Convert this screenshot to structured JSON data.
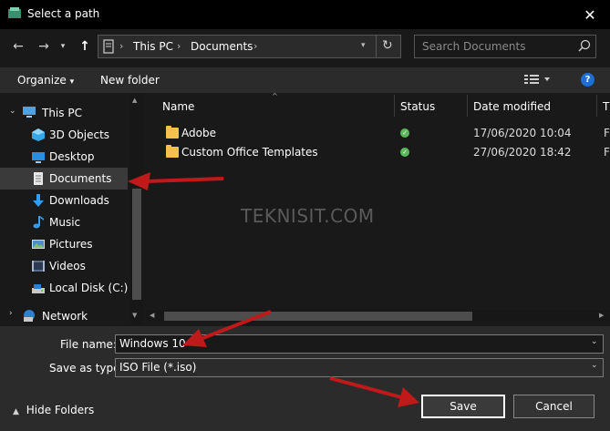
{
  "window": {
    "title": "Select a path",
    "close_icon": "close-icon"
  },
  "nav": {
    "back_icon": "arrow-left-icon",
    "forward_icon": "arrow-right-icon",
    "dropdown_icon": "chevron-down-icon",
    "up_icon": "arrow-up-icon",
    "breadcrumb": [
      "This PC",
      "Documents"
    ],
    "refresh_icon": "refresh-icon",
    "search_placeholder": "Search Documents"
  },
  "toolbar": {
    "organize": "Organize",
    "new_folder": "New folder",
    "view_icon": "view-list-icon",
    "help": "?"
  },
  "sidebar": {
    "items": [
      {
        "label": "This PC",
        "icon": "computer-icon"
      },
      {
        "label": "3D Objects",
        "icon": "cube-icon"
      },
      {
        "label": "Desktop",
        "icon": "desktop-icon"
      },
      {
        "label": "Documents",
        "icon": "document-icon",
        "selected": true
      },
      {
        "label": "Downloads",
        "icon": "download-icon"
      },
      {
        "label": "Music",
        "icon": "music-icon"
      },
      {
        "label": "Pictures",
        "icon": "picture-icon"
      },
      {
        "label": "Videos",
        "icon": "video-icon"
      },
      {
        "label": "Local Disk (C:)",
        "icon": "disk-icon"
      },
      {
        "label": "Network",
        "icon": "network-icon"
      }
    ]
  },
  "filelist": {
    "columns": [
      "Name",
      "Status",
      "Date modified",
      "T"
    ],
    "rows": [
      {
        "name": "Adobe",
        "status_icon": "sync-ok-icon",
        "date": "17/06/2020 10:04",
        "type": "F"
      },
      {
        "name": "Custom Office Templates",
        "status_icon": "sync-ok-icon",
        "date": "27/06/2020 18:42",
        "type": "F"
      }
    ],
    "watermark": "TEKNISIT.COM"
  },
  "form": {
    "file_name_label": "File name:",
    "file_name_value": "Windows 10",
    "save_type_label": "Save as type:",
    "save_type_value": "ISO File (*.iso)"
  },
  "footer": {
    "hide_folders": "Hide Folders",
    "save": "Save",
    "cancel": "Cancel"
  },
  "colors": {
    "annotation_arrow": "#c0191a",
    "background": "#191919"
  }
}
